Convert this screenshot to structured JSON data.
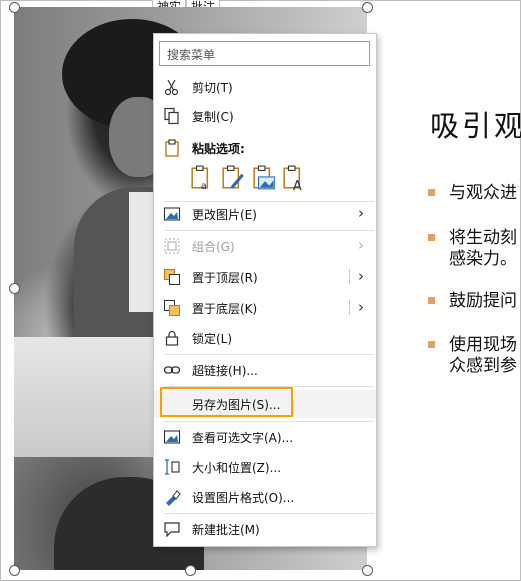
{
  "tabs": [
    "神实",
    "批注"
  ],
  "slide": {
    "title": "吸引观",
    "bullets": [
      {
        "lines": [
          "与观众进"
        ]
      },
      {
        "lines": [
          "将生动刻",
          "感染力。"
        ]
      },
      {
        "lines": [
          "鼓励提问"
        ]
      },
      {
        "lines": [
          "使用现场",
          "众感到参"
        ]
      }
    ]
  },
  "menu": {
    "search_placeholder": "搜索菜单",
    "cut": "剪切(T)",
    "copy": "复制(C)",
    "paste_options": "粘贴选项:",
    "change_picture": "更改图片(E)",
    "group": "组合(G)",
    "bring_to_front": "置于顶层(R)",
    "send_to_back": "置于底层(K)",
    "lock": "锁定(L)",
    "hyperlink": "超链接(H)...",
    "save_as_picture": "另存为图片(S)...",
    "view_alt_text": "查看可选文字(A)...",
    "size_position": "大小和位置(Z)...",
    "format_picture": "设置图片格式(O)...",
    "new_comment": "新建批注(M)"
  },
  "icons": {
    "cut": "scissors-icon",
    "copy": "copy-icon",
    "paste": "clipboard-icon",
    "change_picture": "change-picture-icon",
    "group": "group-icon",
    "bring_to_front": "bring-to-front-icon",
    "send_to_back": "send-to-back-icon",
    "lock": "lock-icon",
    "hyperlink": "link-icon",
    "alt_text": "alt-text-icon",
    "size_position": "size-position-icon",
    "format_picture": "format-picture-icon",
    "comment": "comment-icon"
  },
  "colors": {
    "accent": "#f0a30a",
    "bullet": "#e2a064",
    "icon_orange": "#d08a1e",
    "icon_blue": "#2b6cb0"
  }
}
